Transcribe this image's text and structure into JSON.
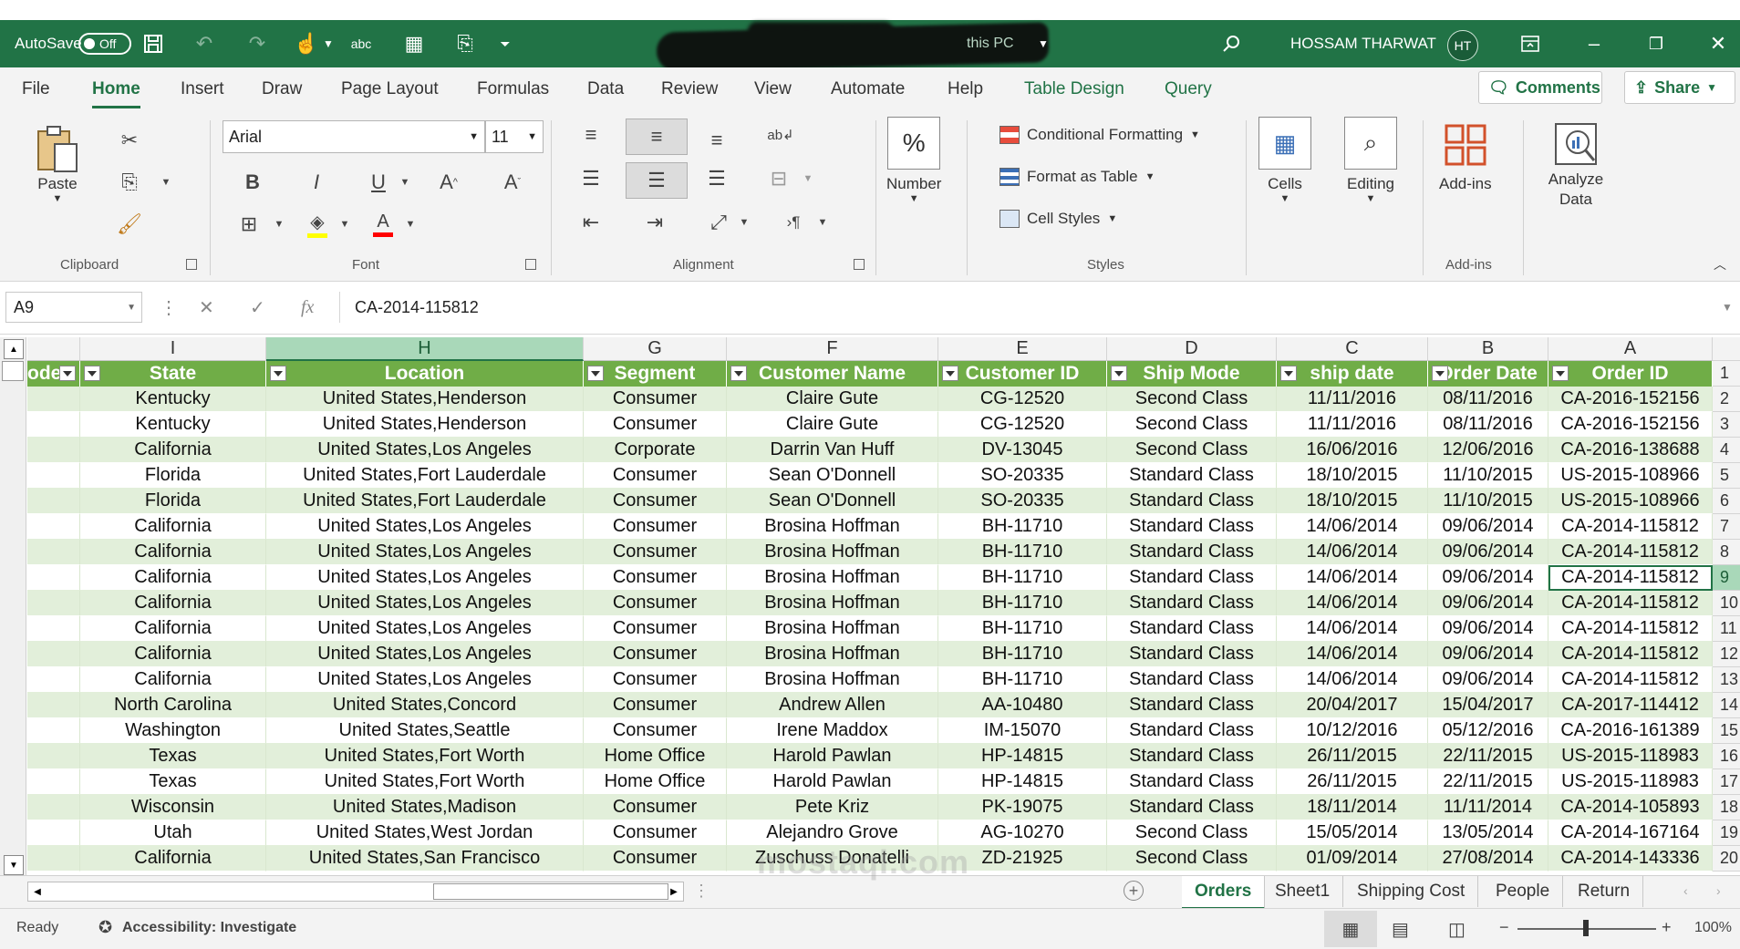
{
  "titlebar": {
    "autosave_label": "AutoSave",
    "autosave_state": "Off",
    "doc_status": "this PC",
    "user_name": "HOSSAM THARWAT",
    "user_initials": "HT"
  },
  "ribbon_tabs": [
    "File",
    "Home",
    "Insert",
    "Draw",
    "Page Layout",
    "Formulas",
    "Data",
    "Review",
    "View",
    "Automate",
    "Help",
    "Table Design",
    "Query"
  ],
  "ribbon_actions": {
    "comments": "Comments",
    "share": "Share"
  },
  "ribbon": {
    "clipboard": {
      "paste": "Paste",
      "group": "Clipboard"
    },
    "font": {
      "name": "Arial",
      "size": "11",
      "group": "Font"
    },
    "alignment": {
      "group": "Alignment"
    },
    "number": {
      "label": "Number",
      "symbol": "%"
    },
    "styles": {
      "conditional": "Conditional Formatting",
      "format_table": "Format as Table",
      "cell_styles": "Cell Styles",
      "group": "Styles"
    },
    "cells": "Cells",
    "editing": "Editing",
    "addins": "Add-ins",
    "addins_group": "Add-ins",
    "analyze": "Analyze Data"
  },
  "formula_bar": {
    "name_box": "A9",
    "fx": "fx",
    "value": "CA-2014-115812"
  },
  "grid": {
    "column_letters": [
      "I",
      "H",
      "G",
      "F",
      "E",
      "D",
      "C",
      "B",
      "A"
    ],
    "partial_header": "ode",
    "headers": [
      "State",
      "Location",
      "Segment",
      "Customer Name",
      "Customer ID",
      "Ship Mode",
      "ship date",
      "Order Date",
      "Order ID"
    ],
    "row_numbers": [
      "1",
      "2",
      "3",
      "4",
      "5",
      "6",
      "7",
      "8",
      "9",
      "10",
      "11",
      "12",
      "13",
      "14",
      "15",
      "16",
      "17",
      "18",
      "19",
      "20"
    ],
    "rows": [
      [
        "Kentucky",
        "United States,Henderson",
        "Consumer",
        "Claire Gute",
        "CG-12520",
        "Second Class",
        "11/11/2016",
        "08/11/2016",
        "CA-2016-152156"
      ],
      [
        "Kentucky",
        "United States,Henderson",
        "Consumer",
        "Claire Gute",
        "CG-12520",
        "Second Class",
        "11/11/2016",
        "08/11/2016",
        "CA-2016-152156"
      ],
      [
        "California",
        "United States,Los Angeles",
        "Corporate",
        "Darrin Van Huff",
        "DV-13045",
        "Second Class",
        "16/06/2016",
        "12/06/2016",
        "CA-2016-138688"
      ],
      [
        "Florida",
        "United States,Fort Lauderdale",
        "Consumer",
        "Sean O'Donnell",
        "SO-20335",
        "Standard Class",
        "18/10/2015",
        "11/10/2015",
        "US-2015-108966"
      ],
      [
        "Florida",
        "United States,Fort Lauderdale",
        "Consumer",
        "Sean O'Donnell",
        "SO-20335",
        "Standard Class",
        "18/10/2015",
        "11/10/2015",
        "US-2015-108966"
      ],
      [
        "California",
        "United States,Los Angeles",
        "Consumer",
        "Brosina Hoffman",
        "BH-11710",
        "Standard Class",
        "14/06/2014",
        "09/06/2014",
        "CA-2014-115812"
      ],
      [
        "California",
        "United States,Los Angeles",
        "Consumer",
        "Brosina Hoffman",
        "BH-11710",
        "Standard Class",
        "14/06/2014",
        "09/06/2014",
        "CA-2014-115812"
      ],
      [
        "California",
        "United States,Los Angeles",
        "Consumer",
        "Brosina Hoffman",
        "BH-11710",
        "Standard Class",
        "14/06/2014",
        "09/06/2014",
        "CA-2014-115812"
      ],
      [
        "California",
        "United States,Los Angeles",
        "Consumer",
        "Brosina Hoffman",
        "BH-11710",
        "Standard Class",
        "14/06/2014",
        "09/06/2014",
        "CA-2014-115812"
      ],
      [
        "California",
        "United States,Los Angeles",
        "Consumer",
        "Brosina Hoffman",
        "BH-11710",
        "Standard Class",
        "14/06/2014",
        "09/06/2014",
        "CA-2014-115812"
      ],
      [
        "California",
        "United States,Los Angeles",
        "Consumer",
        "Brosina Hoffman",
        "BH-11710",
        "Standard Class",
        "14/06/2014",
        "09/06/2014",
        "CA-2014-115812"
      ],
      [
        "California",
        "United States,Los Angeles",
        "Consumer",
        "Brosina Hoffman",
        "BH-11710",
        "Standard Class",
        "14/06/2014",
        "09/06/2014",
        "CA-2014-115812"
      ],
      [
        "North Carolina",
        "United States,Concord",
        "Consumer",
        "Andrew Allen",
        "AA-10480",
        "Standard Class",
        "20/04/2017",
        "15/04/2017",
        "CA-2017-114412"
      ],
      [
        "Washington",
        "United States,Seattle",
        "Consumer",
        "Irene Maddox",
        "IM-15070",
        "Standard Class",
        "10/12/2016",
        "05/12/2016",
        "CA-2016-161389"
      ],
      [
        "Texas",
        "United States,Fort Worth",
        "Home Office",
        "Harold Pawlan",
        "HP-14815",
        "Standard Class",
        "26/11/2015",
        "22/11/2015",
        "US-2015-118983"
      ],
      [
        "Texas",
        "United States,Fort Worth",
        "Home Office",
        "Harold Pawlan",
        "HP-14815",
        "Standard Class",
        "26/11/2015",
        "22/11/2015",
        "US-2015-118983"
      ],
      [
        "Wisconsin",
        "United States,Madison",
        "Consumer",
        "Pete Kriz",
        "PK-19075",
        "Standard Class",
        "18/11/2014",
        "11/11/2014",
        "CA-2014-105893"
      ],
      [
        "Utah",
        "United States,West Jordan",
        "Consumer",
        "Alejandro Grove",
        "AG-10270",
        "Second Class",
        "15/05/2014",
        "13/05/2014",
        "CA-2014-167164"
      ],
      [
        "California",
        "United States,San Francisco",
        "Consumer",
        "Zuschuss Donatelli",
        "ZD-21925",
        "Second Class",
        "01/09/2014",
        "27/08/2014",
        "CA-2014-143336"
      ]
    ]
  },
  "sheet_tabs": [
    "Orders",
    "Sheet1",
    "Shipping Cost",
    "People",
    "Return"
  ],
  "status": {
    "ready": "Ready",
    "accessibility": "Accessibility: Investigate",
    "zoom": "100%"
  },
  "watermark": "mostaql.com",
  "colors": {
    "brand": "#217346",
    "table_header": "#70ad47",
    "band": "#e2efda"
  }
}
